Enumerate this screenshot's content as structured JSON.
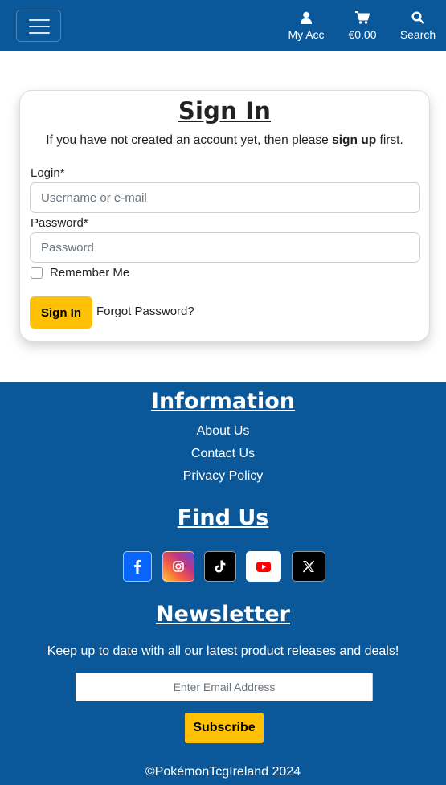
{
  "navbar": {
    "toggle_icon": "hamburger-menu-icon",
    "items": [
      {
        "label": "My Acc",
        "icon": "user-icon"
      },
      {
        "label": "€0.00",
        "icon": "shopping-cart-icon"
      },
      {
        "label": "Search",
        "icon": "search-icon"
      }
    ]
  },
  "signin": {
    "title": "Sign In",
    "intro_before": "If you have not created an account yet, then please ",
    "intro_link": "sign up",
    "intro_after": " first.",
    "login_label": "Login*",
    "login_placeholder": "Username or e-mail",
    "login_value": "",
    "password_label": "Password*",
    "password_placeholder": "Password",
    "password_value": "",
    "remember_label": "Remember Me",
    "remember_checked": false,
    "submit_label": "Sign In",
    "forgot_label": "Forgot Password?"
  },
  "footer": {
    "info_title": "Information",
    "info_links": [
      "About Us",
      "Contact Us",
      "Privacy Policy"
    ],
    "find_title": "Find Us",
    "social": [
      {
        "icon": "facebook-icon",
        "bg": "#0866ff"
      },
      {
        "icon": "instagram-icon",
        "bg": "gradient"
      },
      {
        "icon": "tiktok-icon",
        "bg": "#000000"
      },
      {
        "icon": "youtube-icon",
        "bg": "#ffffff"
      },
      {
        "icon": "x-twitter-icon",
        "bg": "#000000"
      }
    ],
    "newsletter_title": "Newsletter",
    "newsletter_text": "Keep up to date with all our latest product releases and deals!",
    "email_placeholder": "Enter Email Address",
    "email_value": "",
    "subscribe_label": "Subscribe",
    "copyright": "©PokémonTcgIreland 2024"
  },
  "colors": {
    "brand_blue": "#0a5899",
    "accent_yellow": "#ffc107",
    "youtube_red": "#ff0000"
  }
}
